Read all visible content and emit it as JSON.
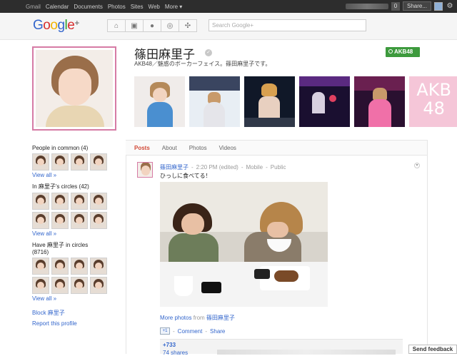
{
  "topbar": {
    "nav": [
      "Gmail",
      "Calendar",
      "Documents",
      "Photos",
      "Sites",
      "Web",
      "More ▾"
    ],
    "notifications": "0",
    "share_label": "Share..."
  },
  "header": {
    "search_placeholder": "Search Google+"
  },
  "profile": {
    "name": "篠田麻里子",
    "tagline": "AKB48／魅惑のボーカーフェイス。篠田麻里子です。",
    "badge": "AKB48",
    "banner_text": "AKB48"
  },
  "tabs": [
    "Posts",
    "About",
    "Photos",
    "Videos"
  ],
  "sidebar": {
    "common_title": "People in common (4)",
    "circles_title": "In 麻里子's circles (42)",
    "have_title": "Have 麻里子 in circles (8716)",
    "view_all": "View all »",
    "block_label": "Block 麻里子",
    "report_label": "Report this profile"
  },
  "post": {
    "author": "篠田麻里子",
    "time": "2:20 PM (edited)",
    "source": "Mobile",
    "visibility": "Public",
    "text": "ひっしに食べてる！",
    "more_photos": "More photos",
    "from": "from",
    "from_author": "篠田麻里子",
    "comment": "Comment",
    "share": "Share",
    "plus_count": "+733",
    "shares_count": "74 shares"
  },
  "feedback": "Send feedback"
}
